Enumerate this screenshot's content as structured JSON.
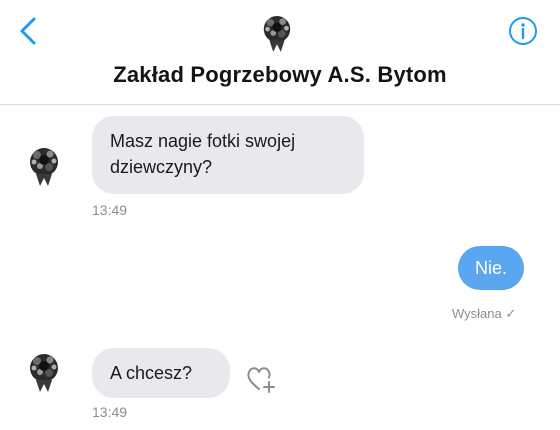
{
  "header": {
    "back_icon": "chevron-left-icon",
    "info_icon": "info-icon",
    "title": "Zakład Pogrzebowy A.S. Bytom",
    "accent_color": "#1d9bf0"
  },
  "messages": [
    {
      "direction": "incoming",
      "text_line1": "Masz nagie fotki swojej",
      "text_line2": "dziewczyny?",
      "time": "13:49"
    },
    {
      "direction": "outgoing",
      "text": "Nie.",
      "status": "Wysłana ✓"
    },
    {
      "direction": "incoming",
      "text": "A chcesz?",
      "time": "13:49",
      "reaction_icon": "heart-add-icon"
    }
  ],
  "colors": {
    "incoming_bubble": "#e8e8ed",
    "outgoing_bubble": "#5aa6f0",
    "meta_text": "#8c8c92"
  }
}
